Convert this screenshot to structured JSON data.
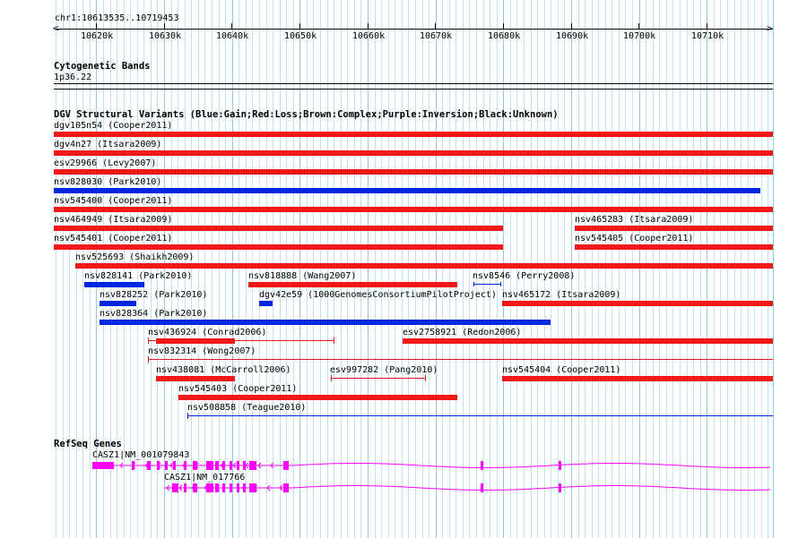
{
  "colors": {
    "gain": "#0028e0",
    "loss": "#f01818",
    "gene": "#ff00ff",
    "grid_minor": "#bfe3ec",
    "grid_major": "#8fcfdf",
    "ruler": "#000000"
  },
  "ruler": {
    "location": "chr1:10613535..10719453",
    "ticks": [
      "10620k",
      "10630k",
      "10640k",
      "10650k",
      "10660k",
      "10670k",
      "10680k",
      "10690k",
      "10700k",
      "10710k"
    ]
  },
  "cytoband": {
    "title": "Cytogenetic Bands",
    "band": "1p36.22"
  },
  "dgv": {
    "title": "DGV Structural Variants (Blue:Gain;Red:Loss;Brown:Complex;Purple:Inversion;Black:Unknown)",
    "features": [
      {
        "label": "dgv105n54 (Cooper2011)",
        "type": "loss",
        "style": "bar"
      },
      {
        "label": "dgv4n27 (Itsara2009)",
        "type": "loss",
        "style": "bar"
      },
      {
        "label": "esv29966 (Levy2007)",
        "type": "loss",
        "style": "bar"
      },
      {
        "label": "nsv828030 (Park2010)",
        "type": "gain",
        "style": "bar"
      },
      {
        "label": "nsv545400 (Cooper2011)",
        "type": "loss",
        "style": "bar"
      },
      {
        "label": "nsv464949 (Itsara2009)",
        "type": "loss",
        "style": "bar"
      },
      {
        "label": "nsv465283 (Itsara2009)",
        "type": "loss",
        "style": "bar"
      },
      {
        "label": "nsv545401 (Cooper2011)",
        "type": "loss",
        "style": "bar"
      },
      {
        "label": "nsv545405 (Cooper2011)",
        "type": "loss",
        "style": "bar"
      },
      {
        "label": "nsv525693 (Shaikh2009)",
        "type": "loss",
        "style": "bar"
      },
      {
        "label": "nsv828141 (Park2010)",
        "type": "gain",
        "style": "bar"
      },
      {
        "label": "nsv818888 (Wang2007)",
        "type": "loss",
        "style": "bar"
      },
      {
        "label": "nsv8546 (Perry2008)",
        "type": "gain",
        "style": "line"
      },
      {
        "label": "nsv828252 (Park2010)",
        "type": "gain",
        "style": "bar"
      },
      {
        "label": "dgv42e59 (1000GenomesConsortiumPilotProject)",
        "type": "gain",
        "style": "bar"
      },
      {
        "label": "nsv465172 (Itsara2009)",
        "type": "loss",
        "style": "bar"
      },
      {
        "label": "nsv828364 (Park2010)",
        "type": "gain",
        "style": "bar"
      },
      {
        "label": "nsv436924 (Conrad2006)",
        "type": "loss",
        "style": "mixed"
      },
      {
        "label": "esv2758921 (Redon2006)",
        "type": "loss",
        "style": "bar"
      },
      {
        "label": "nsv832314 (Wong2007)",
        "type": "loss",
        "style": "line"
      },
      {
        "label": "nsv438081 (McCarroll2006)",
        "type": "loss",
        "style": "bar"
      },
      {
        "label": "esv997282 (Pang2010)",
        "type": "loss",
        "style": "line"
      },
      {
        "label": "nsv545404 (Cooper2011)",
        "type": "loss",
        "style": "bar"
      },
      {
        "label": "nsv545403 (Cooper2011)",
        "type": "loss",
        "style": "bar"
      },
      {
        "label": "nsv508858 (Teague2010)",
        "type": "gain",
        "style": "line"
      }
    ]
  },
  "refseq": {
    "title": "RefSeq Genes",
    "genes": [
      {
        "label": "CASZ1|NM_001079843"
      },
      {
        "label": "CASZ1|NM_017766"
      }
    ]
  }
}
